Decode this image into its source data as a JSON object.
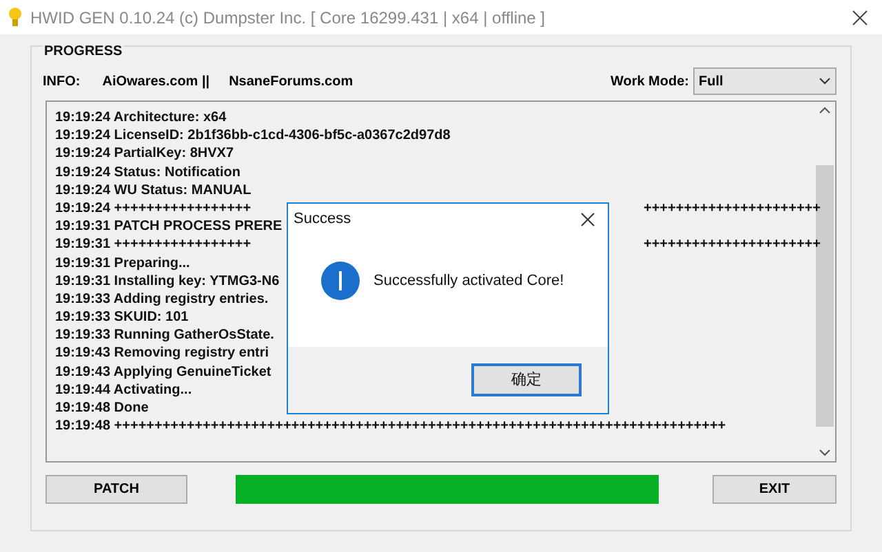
{
  "window": {
    "title": "HWID GEN 0.10.24 (c) Dumpster Inc. [ Core 16299.431 | x64 | offline ]"
  },
  "group": {
    "title": "PROGRESS"
  },
  "info": {
    "label": "INFO:",
    "links": [
      "AiOwares.com ||",
      "NsaneForums.com"
    ]
  },
  "work_mode": {
    "label": "Work Mode:",
    "value": "Full"
  },
  "log": [
    {
      "text": "19:19:24 Architecture: x64"
    },
    {
      "text": "19:19:24 LicenseID: 2b1f36bb-c1cd-4306-bf5c-a0367c2d97d8"
    },
    {
      "text": "19:19:24 PartialKey: 8HVX7"
    },
    {
      "text": "19:19:24 Status: Notification"
    },
    {
      "text": "19:19:24 WU Status: MANUAL"
    },
    {
      "text": "19:19:24 +++++++++++++++++",
      "after": "++++++++++++++++++++++"
    },
    {
      "text": "19:19:31 PATCH PROCESS PRERE"
    },
    {
      "text": "19:19:31 +++++++++++++++++",
      "after": "++++++++++++++++++++++"
    },
    {
      "text": "19:19:31 Preparing..."
    },
    {
      "text": "19:19:31 Installing key: YTMG3-N6"
    },
    {
      "text": "19:19:33 Adding registry entries."
    },
    {
      "text": "19:19:33 SKUID: 101"
    },
    {
      "text": "19:19:33 Running GatherOsState."
    },
    {
      "text": "19:19:43 Removing registry entri"
    },
    {
      "text": "19:19:43 Applying GenuineTicket"
    },
    {
      "text": "19:19:44 Activating..."
    },
    {
      "text": "19:19:48 Done"
    },
    {
      "text": "19:19:48 ++++++++++++++++++++++++++++++++++++++++++++++++++++++++++++++++++++++++++++"
    }
  ],
  "buttons": {
    "patch": "PATCH",
    "exit": "EXIT"
  },
  "progress": {
    "level": 1
  },
  "dialog": {
    "title": "Success",
    "message": "Successfully activated Core!",
    "ok": "确定"
  }
}
